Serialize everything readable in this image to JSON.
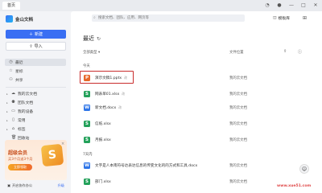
{
  "top_bar": {
    "home_tab": "首页"
  },
  "sidebar": {
    "app_name": "金山文档",
    "new_button": "新建",
    "import_button": "导入",
    "nav_primary": [
      {
        "label": "最近",
        "icon": "clock-icon"
      },
      {
        "label": "星标",
        "icon": "star-icon"
      },
      {
        "label": "共享",
        "icon": "share-icon"
      }
    ],
    "nav_secondary": [
      {
        "label": "我的云文档",
        "icon": "cloud-icon"
      },
      {
        "label": "团队文档",
        "icon": "team-icon"
      },
      {
        "label": "我的设备",
        "icon": "device-icon"
      },
      {
        "label": "常用",
        "icon": "bookmark-icon"
      },
      {
        "label": "标签",
        "icon": "tag-icon"
      },
      {
        "label": "回收站",
        "icon": "trash-icon"
      }
    ],
    "promo": {
      "title": "超级会员",
      "subtitle": "买3个月送3个月",
      "button": "立即领取",
      "badge": "S"
    },
    "bottom": {
      "left": "开启协作办公",
      "right": "升级"
    }
  },
  "main": {
    "search_placeholder": "搜索文档、团队、应用、网页等",
    "template_link": "模板库",
    "section_title": "最近",
    "col_type": "全部类型",
    "col_location": "文件位置",
    "group_today": "今天",
    "group_7days": "7天内",
    "today_files": [
      {
        "name": "演示文稿1.pptx",
        "tag": "改",
        "location": "我的云文档",
        "kind": "P",
        "color": "#e7692b"
      },
      {
        "name": "网表单01.xlsx",
        "tag": "改",
        "location": "我的云文档",
        "kind": "S",
        "color": "#23a15a"
      },
      {
        "name": "新文档.docx",
        "tag": "改",
        "location": "我的云文档",
        "kind": "W",
        "color": "#2f76e8"
      },
      {
        "name": "信纸.xlsx",
        "tag": "",
        "location": "我的云文档",
        "kind": "S",
        "color": "#23a15a"
      },
      {
        "name": "月报.xlsx",
        "tag": "",
        "location": "我的云文档",
        "kind": "S",
        "color": "#23a15a"
      }
    ],
    "week_files": [
      {
        "name": "文字是人本南符号达表达信息的传变文化的的方式和工具.docx",
        "tag": "",
        "location": "我的云文档",
        "kind": "W",
        "color": "#2f76e8"
      },
      {
        "name": "部门.xlsx",
        "tag": "",
        "location": "我的云文档",
        "kind": "S",
        "color": "#23a15a"
      }
    ]
  },
  "watermark": "www.xue51.com"
}
